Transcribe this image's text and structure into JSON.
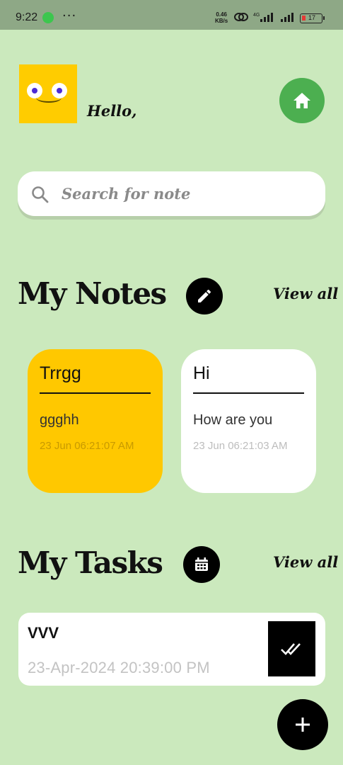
{
  "status_bar": {
    "time": "9:22",
    "menu_dots": "···",
    "speed_value": "0.46",
    "speed_unit": "KB/s",
    "battery": "17"
  },
  "header": {
    "greeting": "Hello,"
  },
  "search": {
    "placeholder": "Search for note"
  },
  "notes_section": {
    "title": "My Notes",
    "view_all": "View all",
    "notes": [
      {
        "title": "Trrgg",
        "body": "ggghh",
        "date": "23 Jun 06:21:07 AM",
        "color": "#ffc800"
      },
      {
        "title": "Hi",
        "body": "How are you",
        "date": "23 Jun 06:21:03 AM",
        "color": "#ffffff"
      }
    ]
  },
  "tasks_section": {
    "title": "My Tasks",
    "view_all": "View all",
    "tasks": [
      {
        "title": "VVV",
        "date": "23-Apr-2024 20:39:00 PM"
      }
    ]
  },
  "colors": {
    "background": "#cbe9bd",
    "home_button": "#4caf50",
    "accent_yellow": "#ffc800",
    "dark": "#000000"
  },
  "icons": [
    "whatsapp-icon",
    "home-icon",
    "search-icon",
    "edit-icon",
    "calendar-icon",
    "done-all-icon",
    "plus-icon"
  ]
}
